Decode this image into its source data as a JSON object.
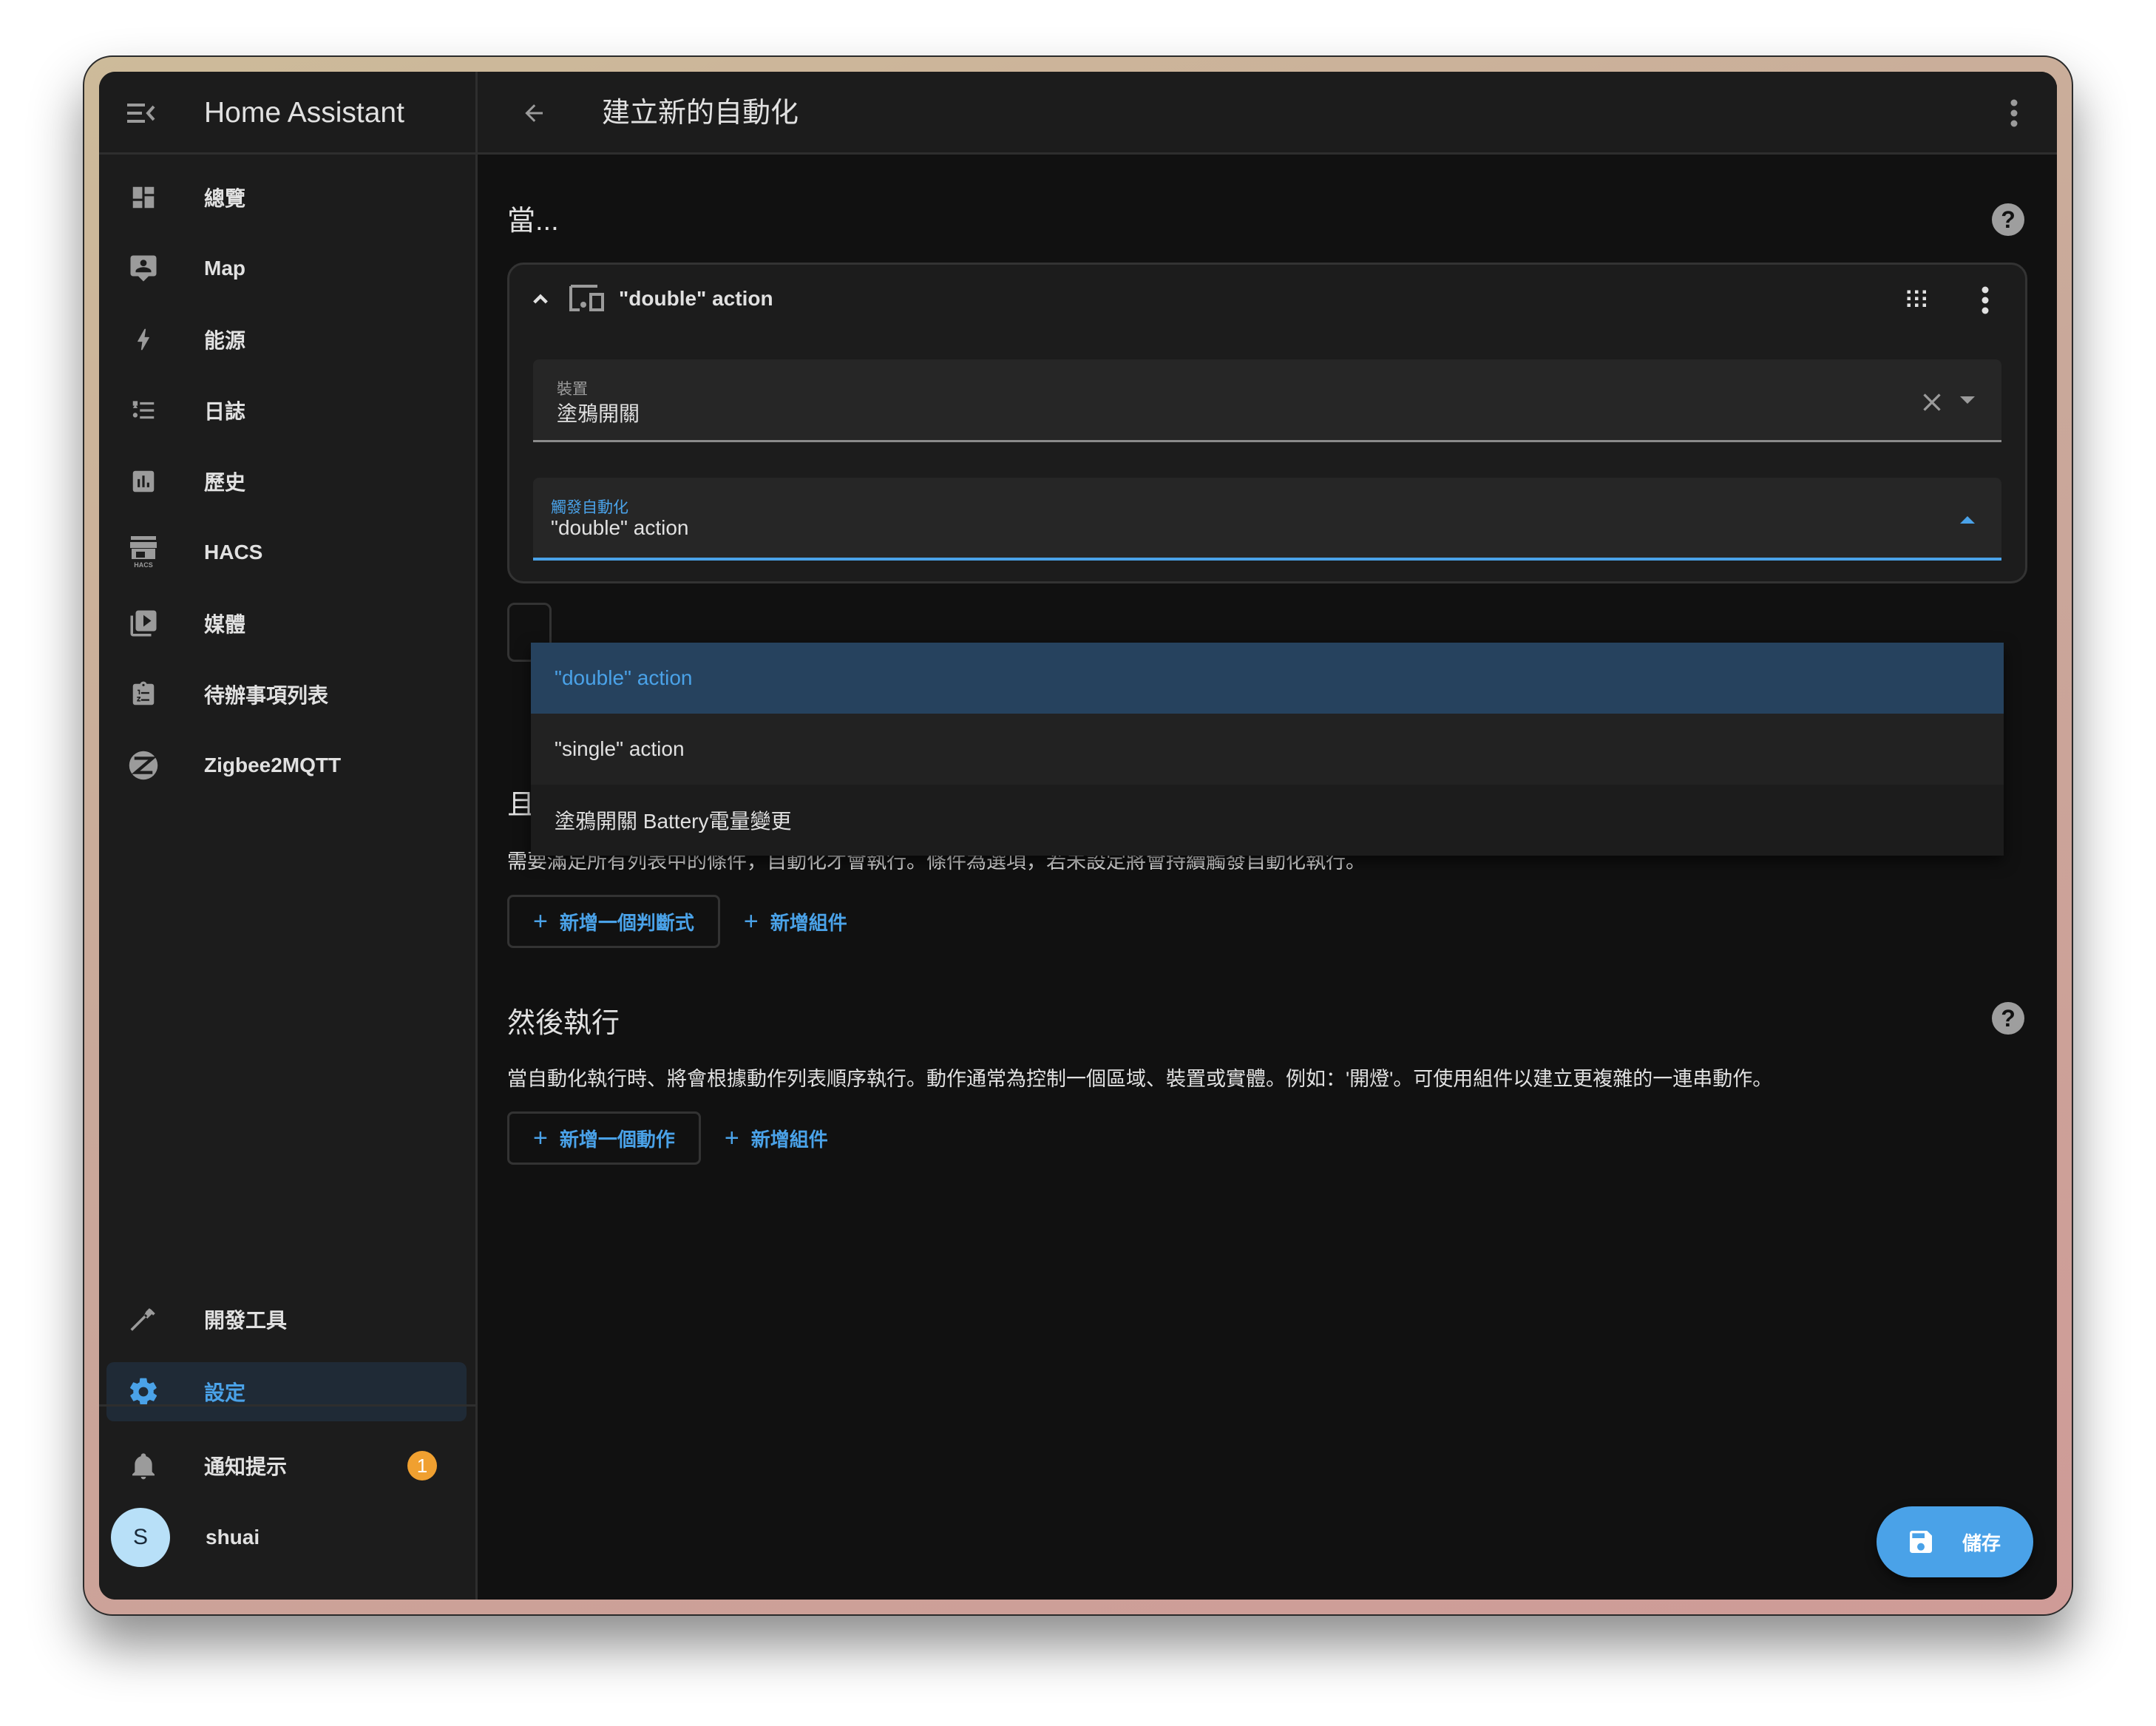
{
  "app": {
    "title": "Home Assistant"
  },
  "sidebar": {
    "items": [
      {
        "label": "總覽",
        "icon": "dashboard-icon"
      },
      {
        "label": "Map",
        "icon": "map-account-icon"
      },
      {
        "label": "能源",
        "icon": "lightning-icon"
      },
      {
        "label": "日誌",
        "icon": "format-list-icon"
      },
      {
        "label": "歷史",
        "icon": "chart-box-icon"
      },
      {
        "label": "HACS",
        "icon": "hacs-icon"
      },
      {
        "label": "媒體",
        "icon": "play-box-multiple-icon"
      },
      {
        "label": "待辦事項列表",
        "icon": "clipboard-list-icon"
      },
      {
        "label": "Zigbee2MQTT",
        "icon": "zigbee-icon"
      }
    ],
    "bottom_items": [
      {
        "label": "開發工具",
        "icon": "hammer-icon"
      },
      {
        "label": "設定",
        "icon": "cog-icon",
        "active": true
      }
    ],
    "notifications": {
      "label": "通知提示",
      "count": "1"
    },
    "user": {
      "name": "shuai",
      "initial": "S"
    }
  },
  "header": {
    "title": "建立新的自動化"
  },
  "triggers": {
    "title": "當...",
    "card": {
      "title": "\"double\" action",
      "device_field": {
        "label": "裝置",
        "value": "塗鴉開關"
      },
      "trigger_field": {
        "label": "觸發自動化",
        "value": "\"double\" action"
      }
    },
    "dropdown_options": [
      {
        "label": "\"double\" action",
        "selected": true
      },
      {
        "label": "\"single\" action",
        "selected": false
      },
      {
        "label": "塗鴉開關 Battery電量變更",
        "selected": false
      }
    ]
  },
  "conditions": {
    "title": "且如果（選項）",
    "description": "需要滿足所有列表中的條件，自動化才會執行。條件為選項，若未設定將會持續觸發自動化執行。",
    "add_button": "新增一個判斷式",
    "add_block_button": "新增組件"
  },
  "actions": {
    "title": "然後執行",
    "description": "當自動化執行時、將會根據動作列表順序執行。動作通常為控制一個區域、裝置或實體。例如：'開燈'。可使用組件以建立更複雜的一連串動作。",
    "add_button": "新增一個動作",
    "add_block_button": "新增組件"
  },
  "save_button": {
    "label": "儲存"
  },
  "colors": {
    "accent": "#4aa2e8",
    "badge": "#f0a030",
    "active_bg": "#1f2a36",
    "selected_option_bg": "#26425e"
  }
}
